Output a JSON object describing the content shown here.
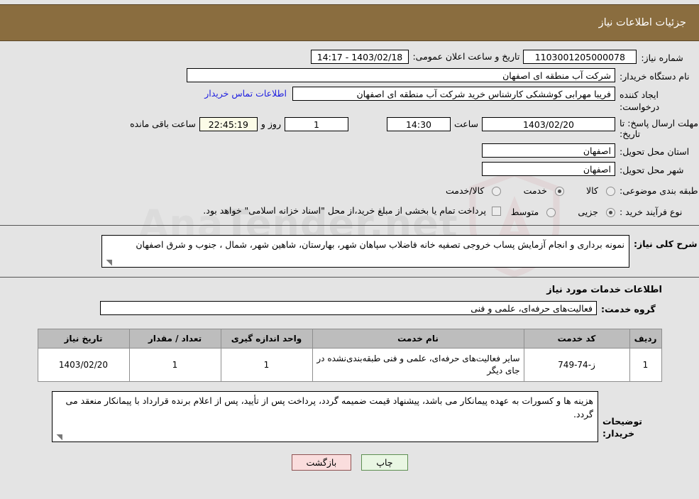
{
  "header": {
    "title": "جزئیات اطلاعات نیاز"
  },
  "watermark": {
    "text_left": "Ana",
    "text_right": "Tender.net"
  },
  "summary": {
    "need_number_label": "شماره نیاز:",
    "need_number_value": "1103001205000078",
    "announce_label": "تاریخ و ساعت اعلان عمومی:",
    "announce_value": "1403/02/18 - 14:17",
    "buyer_org_label": "نام دستگاه خریدار:",
    "buyer_org_value": "شرکت آب منطقه ای اصفهان",
    "creator_label": "ایجاد کننده درخواست:",
    "creator_value": "فریبا مهرابی کوششکی کارشناس خرید شرکت آب منطقه ای اصفهان",
    "contact_link": "اطلاعات تماس خریدار",
    "deadline_label": "مهلت ارسال پاسخ: تا تاریخ:",
    "deadline_date": "1403/02/20",
    "hour_label": "ساعت",
    "deadline_time": "14:30",
    "days_value": "1",
    "days_label": "روز و",
    "countdown_value": "22:45:19",
    "remaining_label": "ساعت باقی مانده",
    "province_label": "استان محل تحویل:",
    "province_value": "اصفهان",
    "city_label": "شهر محل تحویل:",
    "city_value": "اصفهان",
    "category_label": "طبقه بندی موضوعی:",
    "category_options": [
      {
        "label": "کالا",
        "selected": false
      },
      {
        "label": "خدمت",
        "selected": true
      },
      {
        "label": "کالا/خدمت",
        "selected": false
      }
    ],
    "process_label": "نوع فرآیند خرید :",
    "process_options": [
      {
        "label": "جزیی",
        "selected": true
      },
      {
        "label": "متوسط",
        "selected": false
      }
    ],
    "treasury_checkbox_text": "پرداخت تمام یا بخشی از مبلغ خرید،از محل \"اسناد خزانه اسلامی\" خواهد بود.",
    "treasury_checked": false
  },
  "description": {
    "label": "شرح کلی نیاز:",
    "value": "نمونه برداری و انجام آزمایش پساب خروجی تصفیه خانه فاضلاب سپاهان شهر، بهارستان، شاهین شهر، شمال ، جنوب و شرق اصفهان"
  },
  "services_section": {
    "heading": "اطلاعات خدمات مورد نیاز",
    "group_label": "گروه خدمت:",
    "group_value": "فعالیت‌های حرفه‌ای، علمی و فنی"
  },
  "table": {
    "columns": [
      "ردیف",
      "کد خدمت",
      "نام خدمت",
      "واحد اندازه گیری",
      "تعداد / مقدار",
      "تاریخ نیاز"
    ],
    "rows": [
      {
        "index": "1",
        "code": "ز-74-749",
        "name": "سایر فعالیت‌های حرفه‌ای، علمی و فنی طبقه‌بندی‌نشده در جای دیگر",
        "unit": "1",
        "quantity": "1",
        "date": "1403/02/20"
      }
    ]
  },
  "notes": {
    "label": "توضیحات خریدار:",
    "value": "هزینه ها و کسورات به عهده پیمانکار می باشد، پیشنهاد قیمت ضمیمه گردد، پرداخت پس از تأیید، پس از اعلام برنده قرارداد با پیمانکار منعقد می گردد."
  },
  "footer": {
    "print_label": "چاپ",
    "back_label": "بازگشت"
  }
}
